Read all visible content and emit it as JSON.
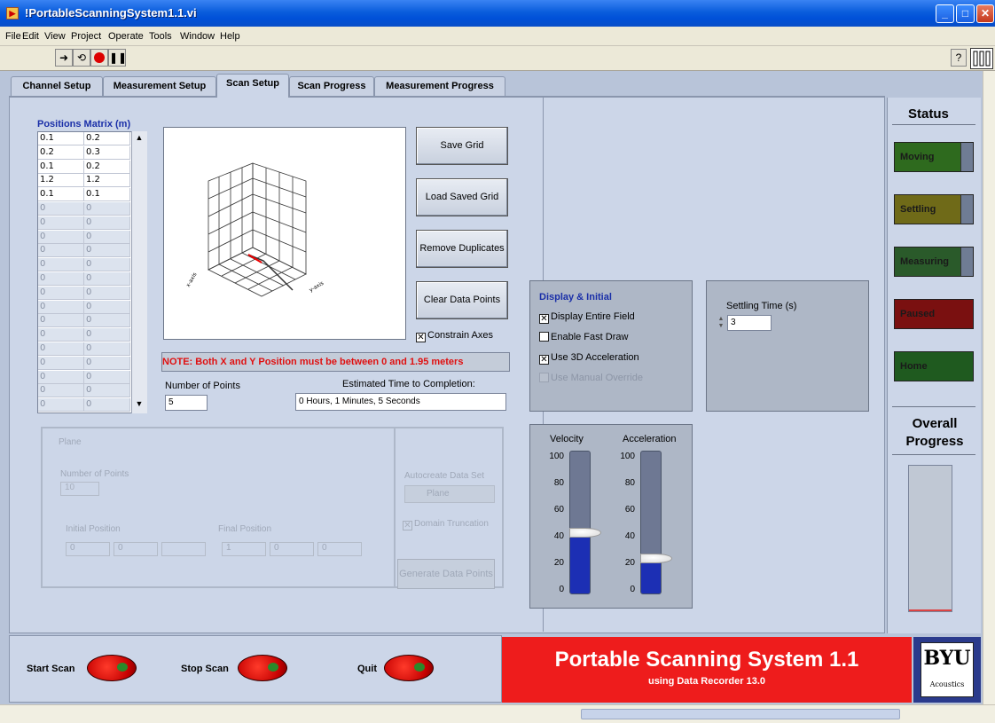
{
  "window": {
    "title": "!PortableScanningSystem1.1.vi"
  },
  "menu": [
    "File",
    "Edit",
    "View",
    "Project",
    "Operate",
    "Tools",
    "Window",
    "Help"
  ],
  "toolbar": {
    "icons": [
      "run-arrow-icon",
      "run-continuously-icon",
      "abort-icon",
      "pause-icon"
    ],
    "help": "?"
  },
  "tabs": [
    "Channel Setup",
    "Measurement Setup",
    "Scan Setup",
    "Scan Progress",
    "Measurement Progress"
  ],
  "active_tab": "Scan Setup",
  "positions": {
    "label": "Positions Matrix (m)",
    "rows": [
      [
        "0.1",
        "0.2"
      ],
      [
        "0.2",
        "0.3"
      ],
      [
        "0.1",
        "0.2"
      ],
      [
        "1.2",
        "1.2"
      ],
      [
        "0.1",
        "0.1"
      ],
      [
        "0",
        "0"
      ],
      [
        "0",
        "0"
      ],
      [
        "0",
        "0"
      ],
      [
        "0",
        "0"
      ],
      [
        "0",
        "0"
      ],
      [
        "0",
        "0"
      ],
      [
        "0",
        "0"
      ],
      [
        "0",
        "0"
      ],
      [
        "0",
        "0"
      ],
      [
        "0",
        "0"
      ],
      [
        "0",
        "0"
      ],
      [
        "0",
        "0"
      ],
      [
        "0",
        "0"
      ],
      [
        "0",
        "0"
      ],
      [
        "0",
        "0"
      ]
    ]
  },
  "buttons": {
    "save_grid": "Save Grid",
    "load_grid": "Load Saved Grid",
    "remove_dup": "Remove Duplicates",
    "clear_points": "Clear Data Points",
    "generate": "Generate Data Points"
  },
  "constrain_axes": "Constrain Axes",
  "note": "NOTE: Both X and Y Position must be between 0 and 1.95 meters",
  "num_points": {
    "label": "Number of Points",
    "value": "5"
  },
  "est_time": {
    "label": "Estimated Time to Completion:",
    "value": "0 Hours, 1 Minutes, 5 Seconds"
  },
  "autocreate": {
    "label": "Autocreate Data Set",
    "value": "Plane",
    "domain_trunc": "Domain Truncation",
    "inputs_left": [
      "0",
      "0",
      ""
    ],
    "inputs_right": [
      "1",
      "0",
      "0"
    ]
  },
  "display": {
    "title": "Display & Initial",
    "items": [
      "Display Entire Field",
      "Enable Fast Draw",
      "Use 3D Acceleration",
      "Use Manual Override"
    ],
    "checked": [
      true,
      false,
      true,
      false
    ]
  },
  "settling": {
    "label": "Settling Time (s)",
    "value": "3"
  },
  "velocity": {
    "label": "Velocity",
    "value": 43
  },
  "acceleration": {
    "label": "Acceleration",
    "value": 25
  },
  "slider_ticks": [
    "100",
    "80",
    "60",
    "40",
    "20",
    "0"
  ],
  "status": {
    "title": "Status",
    "items": [
      "Moving",
      "Settling",
      "Measuring",
      "Paused",
      "Home"
    ],
    "colors": [
      "#2e6a1e",
      "#6f6a18",
      "#2a5a2a",
      "#7a1010",
      "#1f5a1f"
    ]
  },
  "overall": {
    "title": "Overall Progress"
  },
  "bottom": {
    "start": "Start Scan",
    "stop": "Stop Scan",
    "quit": "Quit",
    "banner_title": "Portable Scanning System 1.1",
    "banner_sub": "using Data Recorder 13.0",
    "logo": "BYU",
    "logo_sub": "Acoustics"
  }
}
